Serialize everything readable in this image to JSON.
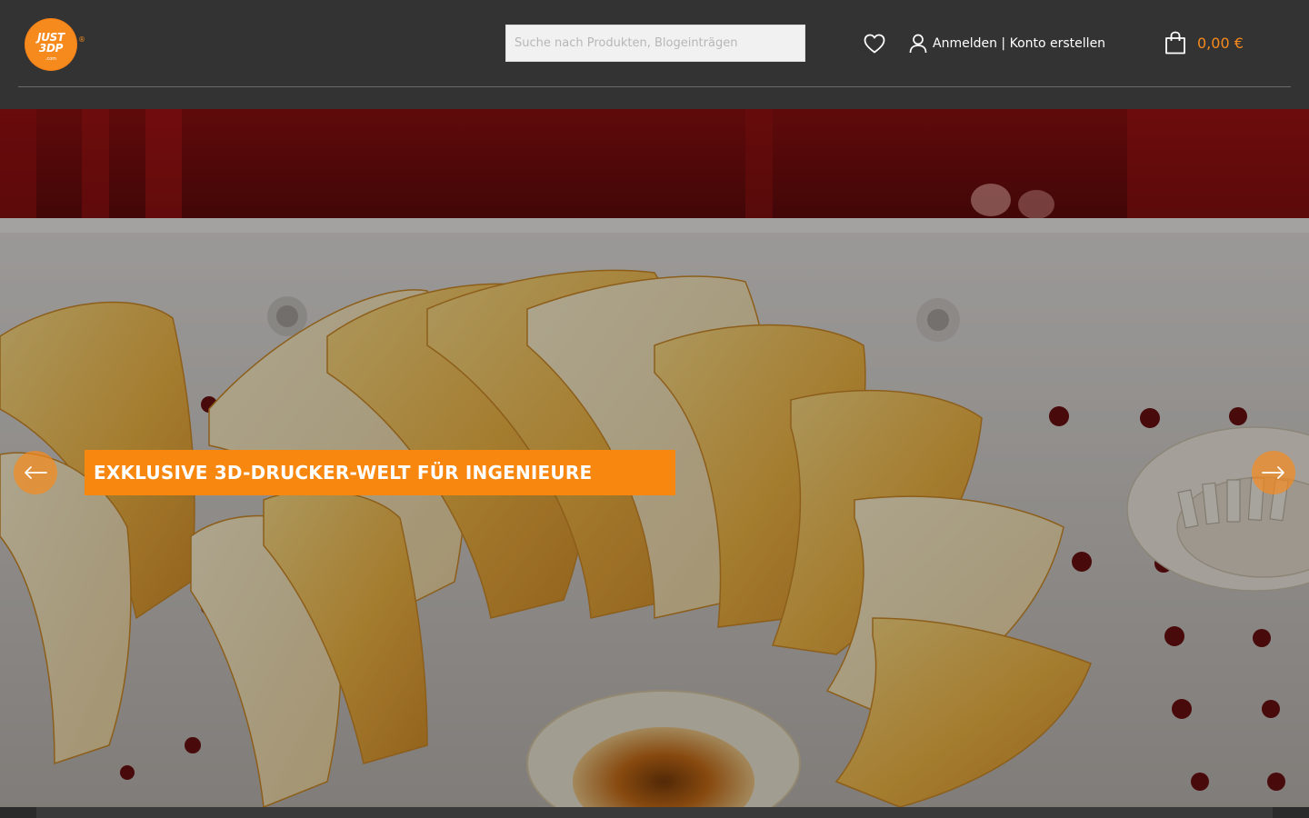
{
  "header": {
    "logo": {
      "line1": "JUST",
      "line2": "3DP",
      "sub": ".com",
      "reg": "®"
    },
    "search": {
      "placeholder": "Suche nach Produkten, Blogeinträgen",
      "value": ""
    },
    "account": {
      "login_label": "Anmelden",
      "separator": " | ",
      "register_label": "Konto erstellen"
    },
    "cart": {
      "total": "0,00 €"
    }
  },
  "hero": {
    "caption": "EXKLUSIVE 3D-DRUCKER-WELT FÜR INGENIEURE",
    "prev_icon": "arrow-left-icon",
    "next_icon": "arrow-right-icon"
  },
  "colors": {
    "background": "#333333",
    "accent": "#f78a1d",
    "caption_bg": "#f7870f",
    "text": "#ffffff"
  },
  "icons": [
    "heart-icon",
    "user-icon",
    "shopping-bag-icon",
    "arrow-left-icon",
    "arrow-right-icon"
  ]
}
